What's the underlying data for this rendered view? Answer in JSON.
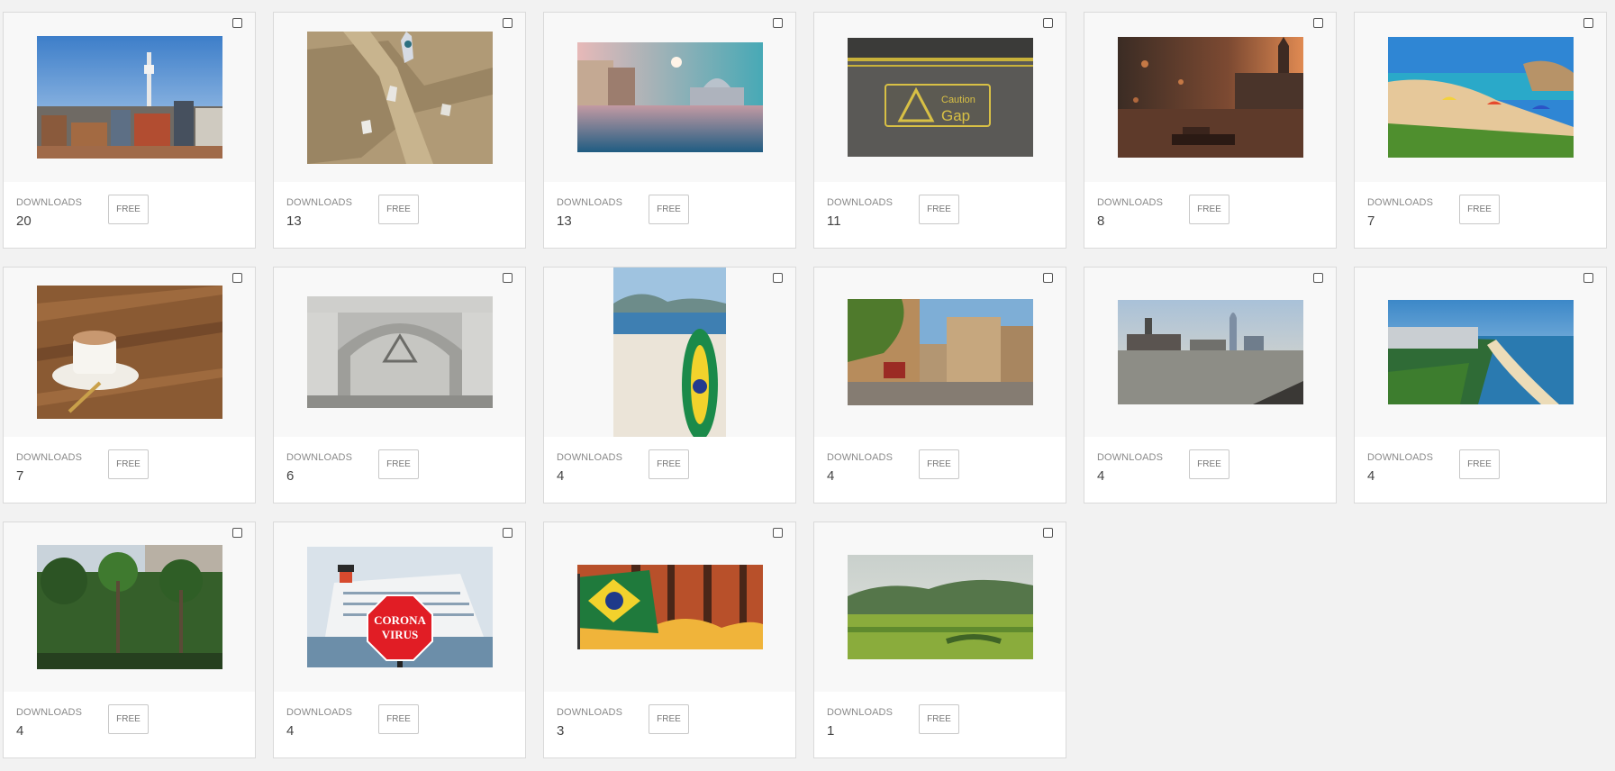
{
  "labels": {
    "downloads": "DOWNLOADS",
    "price": "FREE"
  },
  "items": [
    {
      "image": "city-skyline-tower-photo",
      "downloads": "20"
    },
    {
      "image": "stone-wall-notes-photo",
      "downloads": "13"
    },
    {
      "image": "flooded-venice-photo",
      "downloads": "13"
    },
    {
      "image": "caution-gap-sign-photo",
      "downloads": "11"
    },
    {
      "image": "big-ben-boat-photo",
      "downloads": "8"
    },
    {
      "image": "beach-umbrellas-photo",
      "downloads": "7"
    },
    {
      "image": "cappuccino-cup-photo",
      "downloads": "7"
    },
    {
      "image": "carved-stone-doorway-photo",
      "downloads": "6"
    },
    {
      "image": "surfboard-on-beach-photo",
      "downloads": "4"
    },
    {
      "image": "old-town-street-photo",
      "downloads": "4"
    },
    {
      "image": "river-city-skyline-photo",
      "downloads": "4"
    },
    {
      "image": "coastal-city-bay-photo",
      "downloads": "4"
    },
    {
      "image": "palm-trees-park-photo",
      "downloads": "4"
    },
    {
      "image": "cruise-ship-corona-virus-sign-photo",
      "downloads": "4"
    },
    {
      "image": "flag-forest-fire-photo",
      "downloads": "3"
    },
    {
      "image": "green-hills-field-photo",
      "downloads": "1"
    }
  ],
  "stop_sign_text": [
    "CORONA",
    "VIRUS"
  ],
  "caution_sign_text": [
    "Caution",
    "Gap"
  ]
}
